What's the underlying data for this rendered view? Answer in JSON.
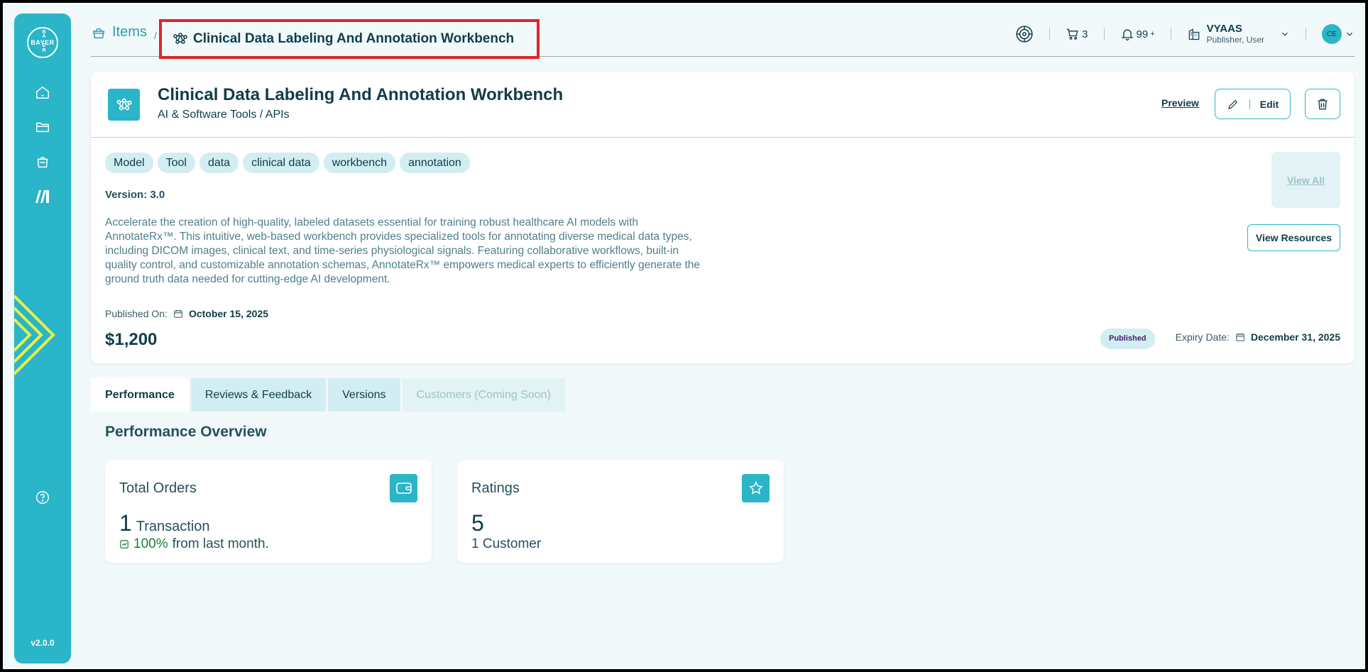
{
  "sidebar": {
    "logo_text": "BAYER",
    "logo_vertical": [
      "B",
      "A",
      "Y",
      "E",
      "R"
    ],
    "nav": [
      "home-icon",
      "folder-icon",
      "shopping-bag-icon",
      "marketplace-icon"
    ],
    "help_icon": "help-icon",
    "version": "v2.0.0"
  },
  "header": {
    "breadcrumb_root": "Items",
    "breadcrumb_sep": "/",
    "breadcrumb_current": "Clinical Data Labeling And Annotation Workbench",
    "cart_count": "3",
    "notifications": "99",
    "notifications_plus": "+",
    "user_name": "VYAAS",
    "user_role": "Publisher, User",
    "avatar_initials": "CE"
  },
  "item": {
    "title": "Clinical Data Labeling And Annotation Workbench",
    "category": "AI & Software Tools / APIs",
    "preview_label": "Preview",
    "edit_label": "Edit",
    "tags": [
      "Model",
      "Tool",
      "data",
      "clinical data",
      "workbench",
      "annotation"
    ],
    "version_label": "Version: 3.0",
    "description": "Accelerate the creation of high-quality, labeled datasets essential for training robust healthcare AI models with AnnotateRx™. This intuitive, web-based workbench provides specialized tools for annotating diverse medical data types, including DICOM images, clinical text, and time-series physiological signals. Featuring collaborative workflows, built-in quality control, and customizable annotation schemas, AnnotateRx™ empowers medical experts to efficiently generate the ground truth data needed for cutting-edge AI development.",
    "published_label": "Published On:",
    "published_date": "October 15, 2025",
    "price": "$1,200",
    "view_all_label": "View All",
    "view_resources_label": "View Resources",
    "status_badge": "Published",
    "expiry_label": "Expiry Date:",
    "expiry_date": "December 31, 2025"
  },
  "tabs": [
    {
      "label": "Performance",
      "state": "active"
    },
    {
      "label": "Reviews & Feedback",
      "state": "normal"
    },
    {
      "label": "Versions",
      "state": "normal"
    },
    {
      "label": "Customers (Coming Soon)",
      "state": "disabled"
    }
  ],
  "performance": {
    "title": "Performance Overview",
    "orders": {
      "label": "Total Orders",
      "value": "1",
      "unit": "Transaction",
      "pct": "100%",
      "pct_suffix": "from last month."
    },
    "ratings": {
      "label": "Ratings",
      "value": "5",
      "sub": "1 Customer"
    }
  },
  "colors": {
    "accent": "#2ab5c8",
    "text": "#0f3d4a",
    "highlight": "#e0242a",
    "tag_bg": "#d3eef2"
  }
}
